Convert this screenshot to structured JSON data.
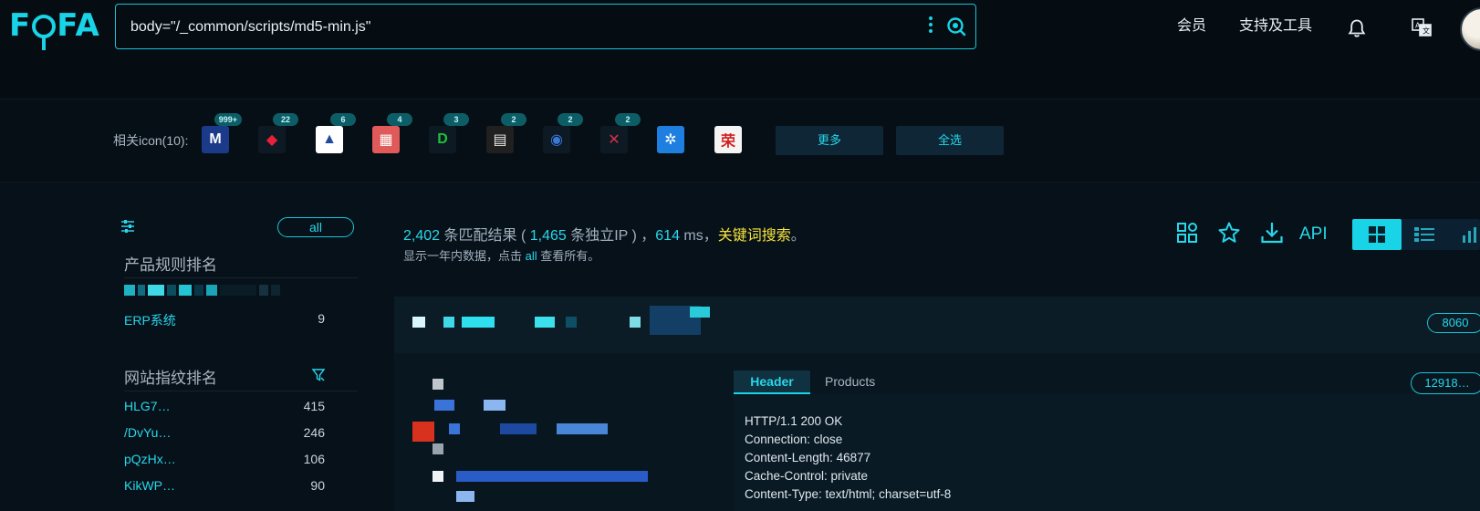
{
  "header": {
    "logo": "FOFA",
    "search_value": "body=\"/_common/scripts/md5-min.js\"",
    "nav": {
      "member": "会员",
      "tools": "支持及工具"
    }
  },
  "icons": {
    "label": "相关icon(10):",
    "items": [
      {
        "glyph": "M",
        "badge": "999+",
        "bg": "#1b3a8a",
        "color": "#ffffff"
      },
      {
        "glyph": "◆",
        "badge": "22",
        "bg": "#0d1a24",
        "color": "#e8213a"
      },
      {
        "glyph": "▲",
        "badge": "6",
        "bg": "#ffffff",
        "color": "#1f4aa0"
      },
      {
        "glyph": "▦",
        "badge": "4",
        "bg": "#e05a5a",
        "color": "#ffffff"
      },
      {
        "glyph": "D",
        "badge": "3",
        "bg": "#0d1a24",
        "color": "#1fbf3a"
      },
      {
        "glyph": "▤",
        "badge": "2",
        "bg": "#202020",
        "color": "#e8e8e8"
      },
      {
        "glyph": "◉",
        "badge": "2",
        "bg": "#0d1a24",
        "color": "#3a78d8"
      },
      {
        "glyph": "✕",
        "badge": "2",
        "bg": "#0d1a24",
        "color": "#d8304a"
      },
      {
        "glyph": "✲",
        "badge": "",
        "bg": "#1e7fe0",
        "color": "#ffffff"
      },
      {
        "glyph": "荣",
        "badge": "",
        "bg": "#f4f4f4",
        "color": "#d21f1f"
      }
    ],
    "more_label": "更多",
    "select_all_label": "全选"
  },
  "sidebar": {
    "all_label": "all",
    "product_title": "产品规则排名",
    "product_rows": [
      {
        "name": "ERP系统",
        "count": "9"
      }
    ],
    "fingerprint_title": "网站指纹排名",
    "fingerprint_rows": [
      {
        "name": "HLG7…",
        "count": "415"
      },
      {
        "name": "/DvYu…",
        "count": "246"
      },
      {
        "name": "pQzHx…",
        "count": "106"
      },
      {
        "name": "KikWP…",
        "count": "90"
      }
    ]
  },
  "stats": {
    "results": "2,402",
    "results_text": " 条匹配结果 ( ",
    "ips": "1,465",
    "ips_text": " 条独立IP ) ，",
    "ms": "614",
    "ms_text": " ms，",
    "keyword": "关键词搜索",
    "keyword_tail": "。",
    "sub_prefix": "显示一年内数据，点击 ",
    "sub_link": "all",
    "sub_suffix": " 查看所有。",
    "api_label": "API"
  },
  "result": {
    "port": "8060",
    "port2": "12918…",
    "tabs": {
      "header": "Header",
      "products": "Products"
    },
    "http_lines": [
      "HTTP/1.1 200 OK",
      "Connection: close",
      "Content-Length: 46877",
      "Cache-Control: private",
      "Content-Type: text/html; charset=utf-8"
    ]
  },
  "colors": {
    "accent": "#19d3e6",
    "keyword": "#f5e23a",
    "background": "#07111a"
  }
}
